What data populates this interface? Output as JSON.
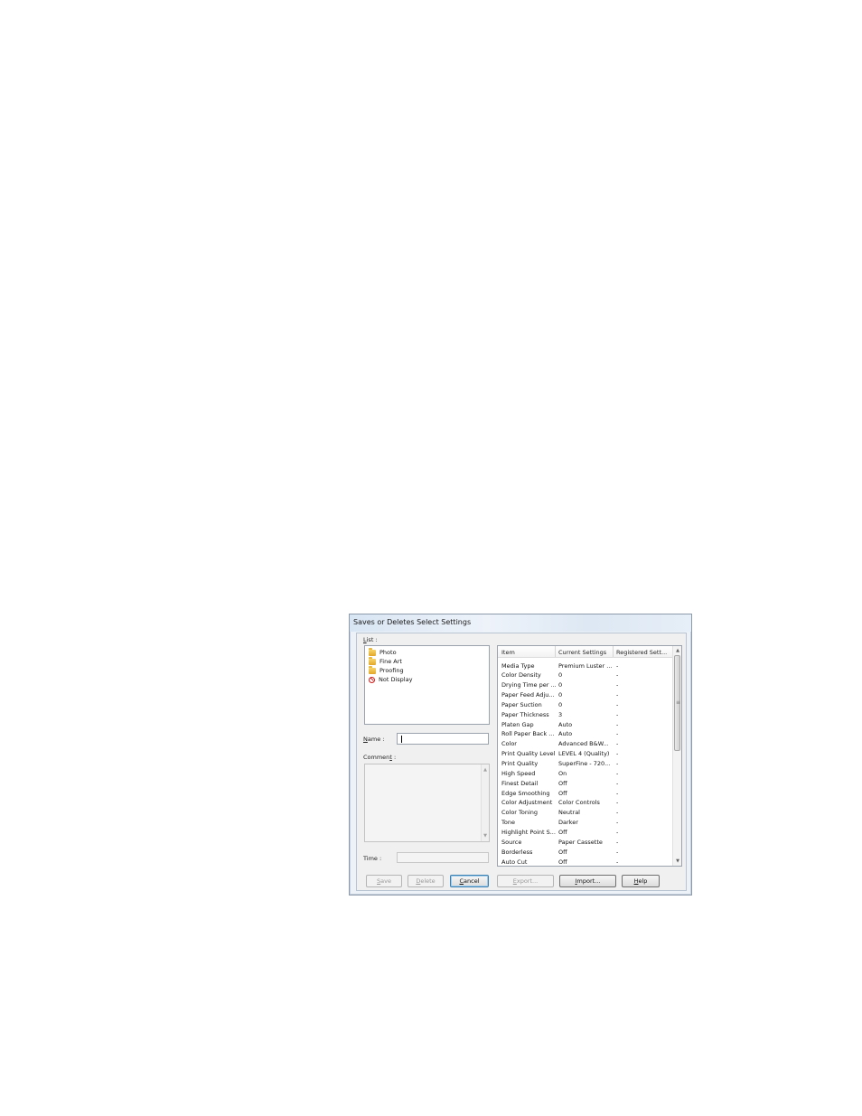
{
  "dialog": {
    "title": "Saves or Deletes Select Settings",
    "list_label_key": "L",
    "list_label_rest": "ist :",
    "list_items": [
      {
        "label": "Photo",
        "icon": "folder-icon"
      },
      {
        "label": "Fine Art",
        "icon": "folder-icon"
      },
      {
        "label": "Proofing",
        "icon": "folder-icon"
      },
      {
        "label": "Not Display",
        "icon": "no-display-icon"
      }
    ],
    "name_label_key": "N",
    "name_label_rest": "ame :",
    "name_value": "",
    "comment_label_pre": "Commen",
    "comment_label_key": "t",
    "comment_label_rest": " :",
    "comment_value": "",
    "time_label": "Time :",
    "time_value": ""
  },
  "settings_table": {
    "headers": [
      "Item",
      "Current Settings",
      "Registered Sett..."
    ],
    "rows": [
      [
        "Media Type",
        "Premium Luster ...",
        "-"
      ],
      [
        "Color Density",
        "0",
        "-"
      ],
      [
        "Drying Time per ...",
        "0",
        "-"
      ],
      [
        "Paper Feed Adju...",
        "0",
        "-"
      ],
      [
        "Paper Suction",
        "0",
        "-"
      ],
      [
        "Paper Thickness",
        "3",
        "-"
      ],
      [
        "Platen Gap",
        "Auto",
        "-"
      ],
      [
        "Roll Paper Back ...",
        "Auto",
        "-"
      ],
      [
        "Color",
        "Advanced B&W...",
        "-"
      ],
      [
        "Print Quality Level",
        "LEVEL 4 (Quality)",
        "-"
      ],
      [
        "Print Quality",
        "SuperFine - 720...",
        "-"
      ],
      [
        "High Speed",
        "On",
        "-"
      ],
      [
        "Finest Detail",
        "Off",
        "-"
      ],
      [
        "Edge Smoothing",
        "Off",
        "-"
      ],
      [
        "Color Adjustment",
        "Color Controls",
        "-"
      ],
      [
        "Color Toning",
        "Neutral",
        "-"
      ],
      [
        "Tone",
        "Darker",
        "-"
      ],
      [
        "Highlight Point S...",
        "Off",
        "-"
      ],
      [
        "Source",
        "Paper Cassette",
        "-"
      ],
      [
        "Borderless",
        "Off",
        "-"
      ],
      [
        "Auto Cut",
        "Off",
        "-"
      ]
    ]
  },
  "buttons": {
    "save": {
      "key": "S",
      "rest": "ave"
    },
    "delete": {
      "key": "D",
      "rest": "elete"
    },
    "cancel": {
      "key": "C",
      "rest": "ancel"
    },
    "export": {
      "key": "E",
      "rest": "xport..."
    },
    "import": {
      "key": "I",
      "rest": "mport..."
    },
    "help": {
      "key": "H",
      "rest": "elp"
    }
  },
  "colors": {
    "title_gradient": "#dfe9f5",
    "client_bg": "#f0f0f0",
    "default_button_border": "#3c7fb1",
    "no_display_red": "#d11c1c"
  }
}
